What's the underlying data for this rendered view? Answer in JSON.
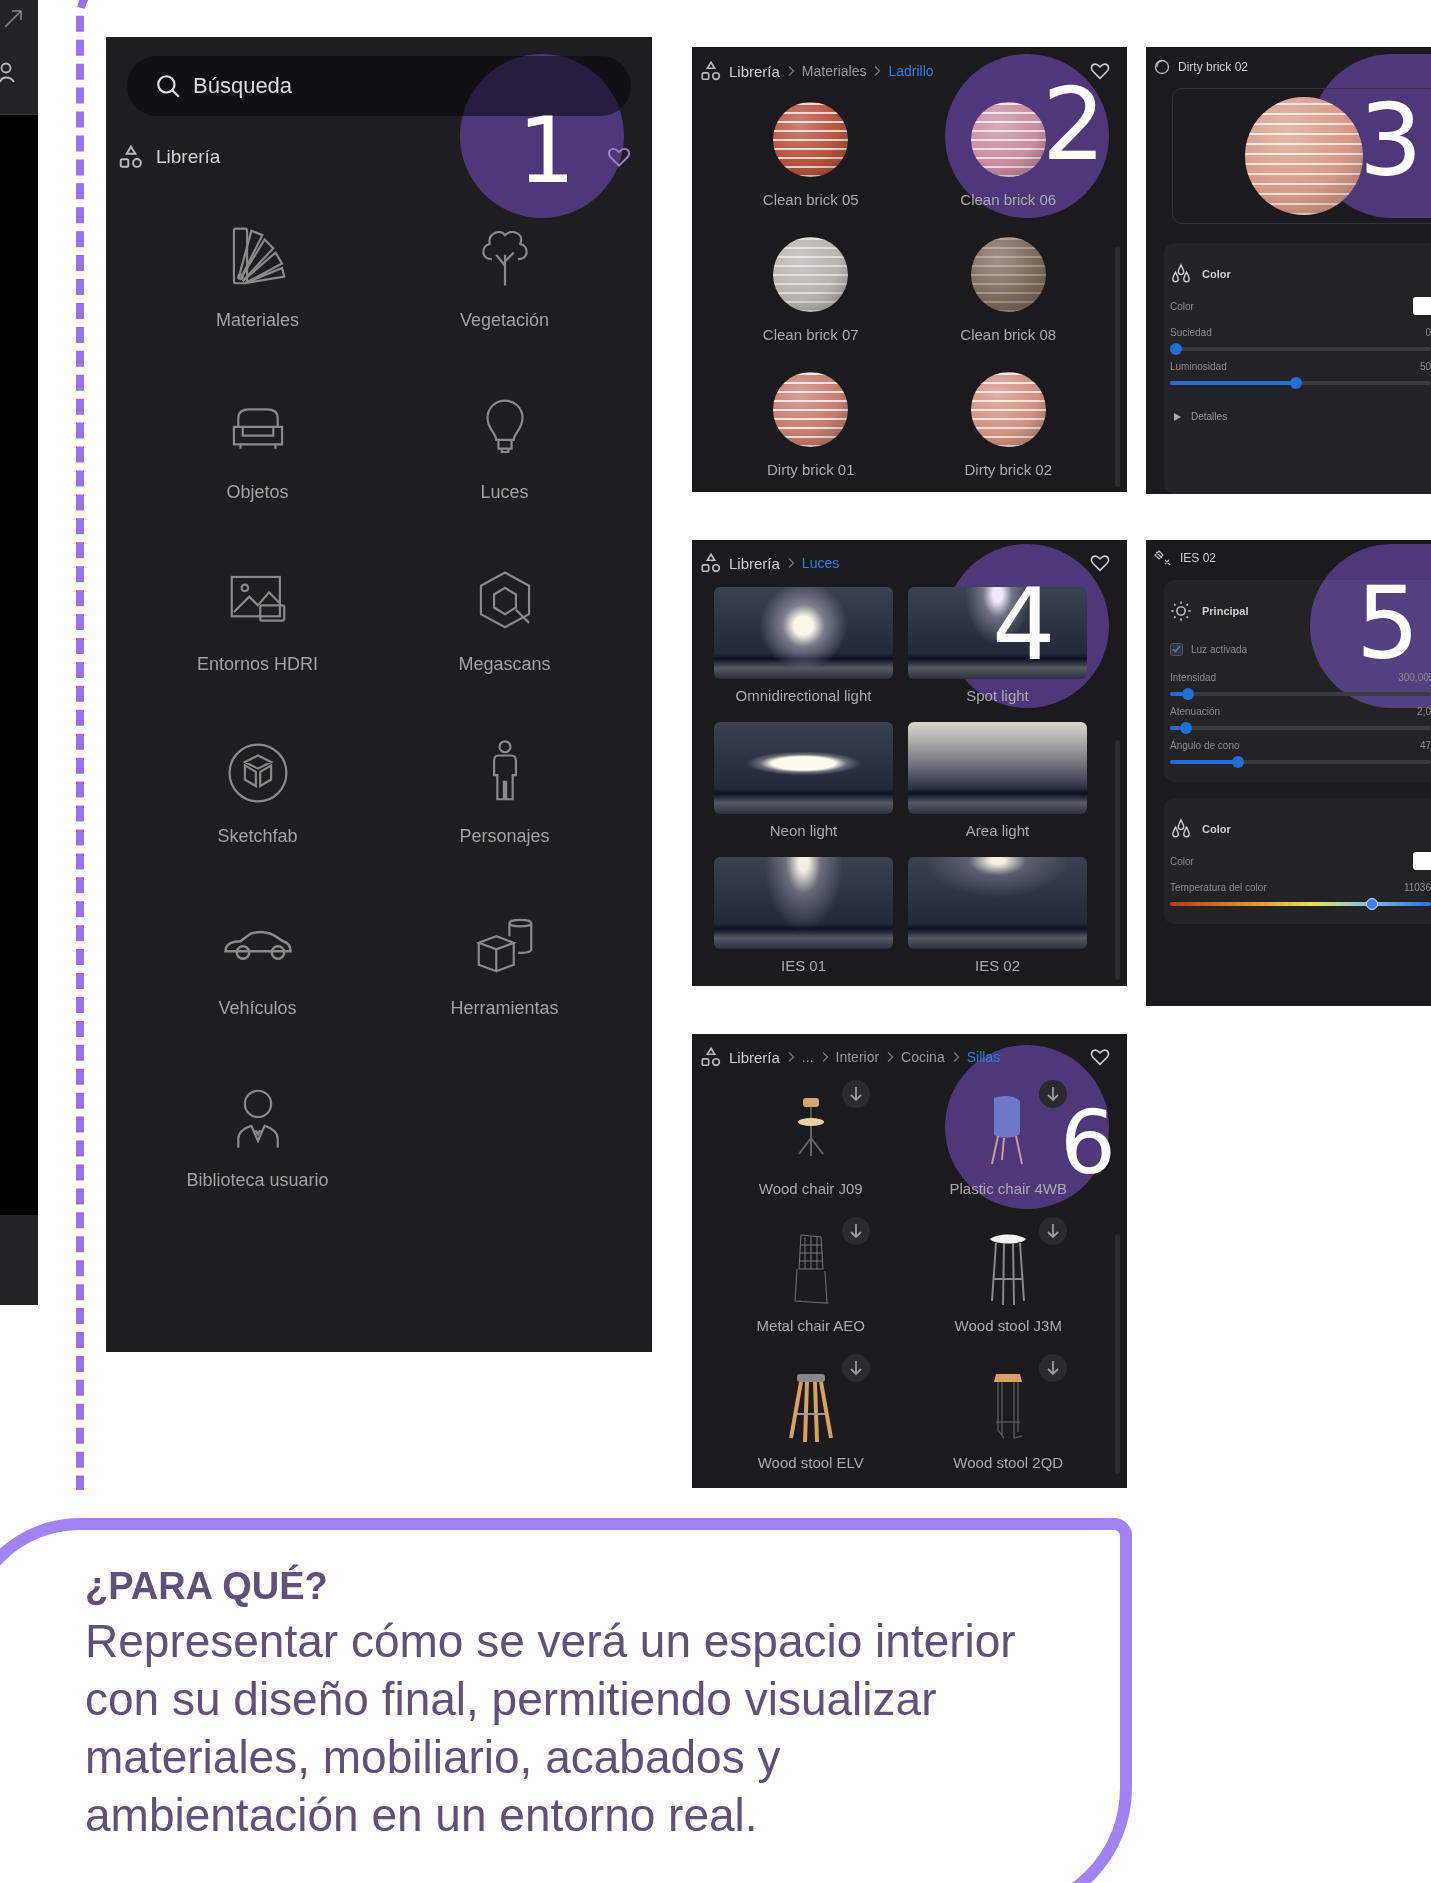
{
  "library_panel": {
    "badge": "1",
    "search": {
      "placeholder": "Búsqueda"
    },
    "title": "Librería",
    "categories": [
      {
        "label": "Materiales"
      },
      {
        "label": "Vegetación"
      },
      {
        "label": "Objetos"
      },
      {
        "label": "Luces"
      },
      {
        "label": "Entornos HDRI"
      },
      {
        "label": "Megascans"
      },
      {
        "label": "Sketchfab"
      },
      {
        "label": "Personajes"
      },
      {
        "label": "Vehículos"
      },
      {
        "label": "Herramientas"
      },
      {
        "label": "Biblioteca usuario"
      }
    ]
  },
  "materials_panel": {
    "badge": "2",
    "breadcrumb": [
      {
        "label": "Librería",
        "selected": false
      },
      {
        "label": "Materiales",
        "selected": false
      },
      {
        "label": "Ladrillo",
        "selected": true
      }
    ],
    "items": [
      {
        "name": "Clean brick 05",
        "kind": "red"
      },
      {
        "name": "Clean brick 06",
        "kind": "pink"
      },
      {
        "name": "Clean brick 07",
        "kind": "grey"
      },
      {
        "name": "Clean brick 08",
        "kind": "brown"
      },
      {
        "name": "Dirty brick 01",
        "kind": "dirty"
      },
      {
        "name": "Dirty brick 02",
        "kind": "salmon"
      }
    ]
  },
  "material_editor": {
    "badge": "3",
    "title": "Dirty brick 02",
    "section": "Color",
    "color_label": "Color",
    "sliders": [
      {
        "label": "Suciedad",
        "reading": "0",
        "level": 0
      },
      {
        "label": "Luminosidad",
        "reading": "50",
        "level": 0.5
      }
    ],
    "details": "Detalles"
  },
  "lights_panel": {
    "badge": "4",
    "breadcrumb": [
      {
        "label": "Librería",
        "selected": false
      },
      {
        "label": "Luces",
        "selected": true
      }
    ],
    "items": [
      {
        "name": "Omnidirectional light",
        "kind": "omni"
      },
      {
        "name": "Spot light",
        "kind": "spot"
      },
      {
        "name": "Neon light",
        "kind": "neon"
      },
      {
        "name": "Area light",
        "kind": "area"
      },
      {
        "name": "IES 01",
        "kind": "ies"
      },
      {
        "name": "IES 02",
        "kind": "ies-wide"
      }
    ]
  },
  "light_editor": {
    "badge": "5",
    "title": "IES 02",
    "main_section": "Principal",
    "enabled": {
      "label": "Luz activada",
      "checked": true
    },
    "sliders": [
      {
        "label": "Intensidad",
        "reading": "300,00l",
        "level": 0.05
      },
      {
        "label": "Atenuación",
        "reading": "2,0",
        "level": 0.04
      },
      {
        "label": "Ángulo de cono",
        "reading": "47",
        "level": 0.26
      }
    ],
    "color_section": "Color",
    "color_label": "Color",
    "temperature": {
      "label": "Temperatura del color",
      "reading": "11036",
      "level": 0.82
    }
  },
  "models_panel": {
    "badge": "6",
    "breadcrumb": [
      {
        "label": "Librería",
        "selected": false
      },
      {
        "label": "...",
        "selected": false
      },
      {
        "label": "Interior",
        "selected": false
      },
      {
        "label": "Cocina",
        "selected": false
      },
      {
        "label": "Sillas",
        "selected": true
      }
    ],
    "items": [
      {
        "name": "Wood chair J09",
        "kind": "swivel-chair"
      },
      {
        "name": "Plastic chair 4WB",
        "kind": "plastic-chair"
      },
      {
        "name": "Metal chair AEO",
        "kind": "wire-chair"
      },
      {
        "name": "Wood stool J3M",
        "kind": "white-stool"
      },
      {
        "name": "Wood stool ELV",
        "kind": "wood-stool"
      },
      {
        "name": "Wood stool 2QD",
        "kind": "bar-stool"
      }
    ]
  },
  "info_card": {
    "heading": "¿PARA QUÉ?",
    "text": "Representar cómo se verá un espacio interior con su diseño final, permitiendo visualizar materiales, mobiliario, acabados y ambientación en un entorno real."
  }
}
